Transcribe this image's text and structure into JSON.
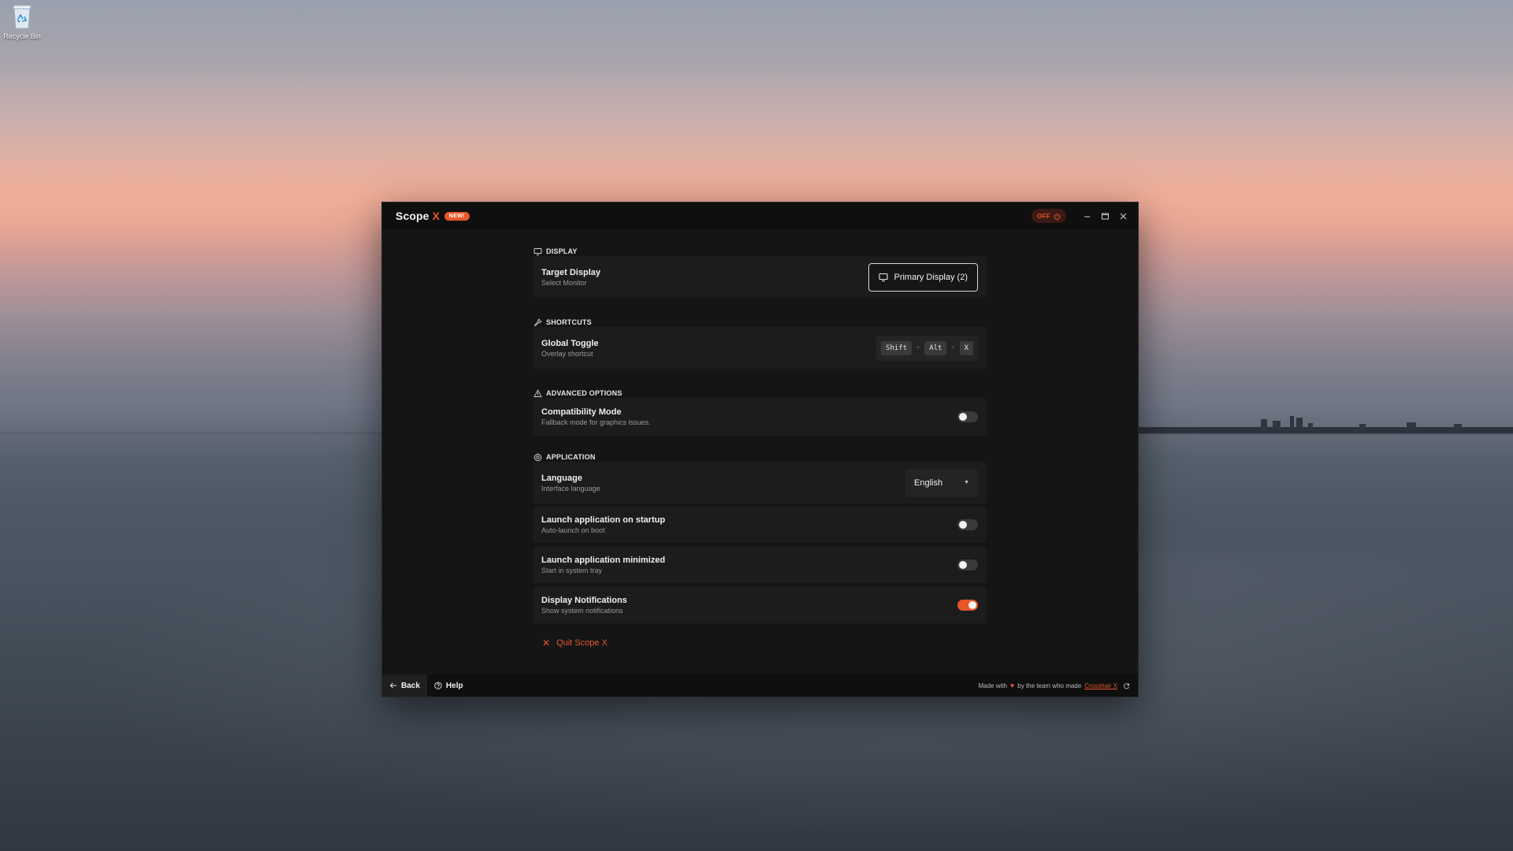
{
  "desktop": {
    "recycle_bin_label": "Recycle Bin"
  },
  "app": {
    "title": "Scope",
    "title_x": "X",
    "new_badge": "NEW!",
    "power_status": "OFF",
    "accent_color": "#e8562a"
  },
  "sections": {
    "display": {
      "header": "DISPLAY",
      "target_title": "Target Display",
      "target_sub": "Select Monitor",
      "target_value": "Primary Display (2)"
    },
    "shortcuts": {
      "header": "SHORTCUTS",
      "toggle_title": "Global Toggle",
      "toggle_sub": "Overlay shortcut",
      "keys": [
        "Shift",
        "Alt",
        "X"
      ],
      "separator": "+"
    },
    "advanced": {
      "header": "ADVANCED OPTIONS",
      "compat_title": "Compatibility Mode",
      "compat_sub": "Fallback mode for graphics issues.",
      "compat_on": false
    },
    "application": {
      "header": "APPLICATION",
      "language_title": "Language",
      "language_sub": "Interface language",
      "language_value": "English",
      "startup_title": "Launch application on startup",
      "startup_sub": "Auto-launch on boot",
      "startup_on": false,
      "minimized_title": "Launch application minimized",
      "minimized_sub": "Start in system tray",
      "minimized_on": false,
      "notifications_title": "Display Notifications",
      "notifications_sub": "Show system notifications",
      "notifications_on": true
    }
  },
  "quit_label": "Quit Scope X",
  "footer": {
    "back_label": "Back",
    "help_label": "Help",
    "made_with": "Made with",
    "by_team": "by the team who made",
    "link_label": "Crosshair X"
  }
}
